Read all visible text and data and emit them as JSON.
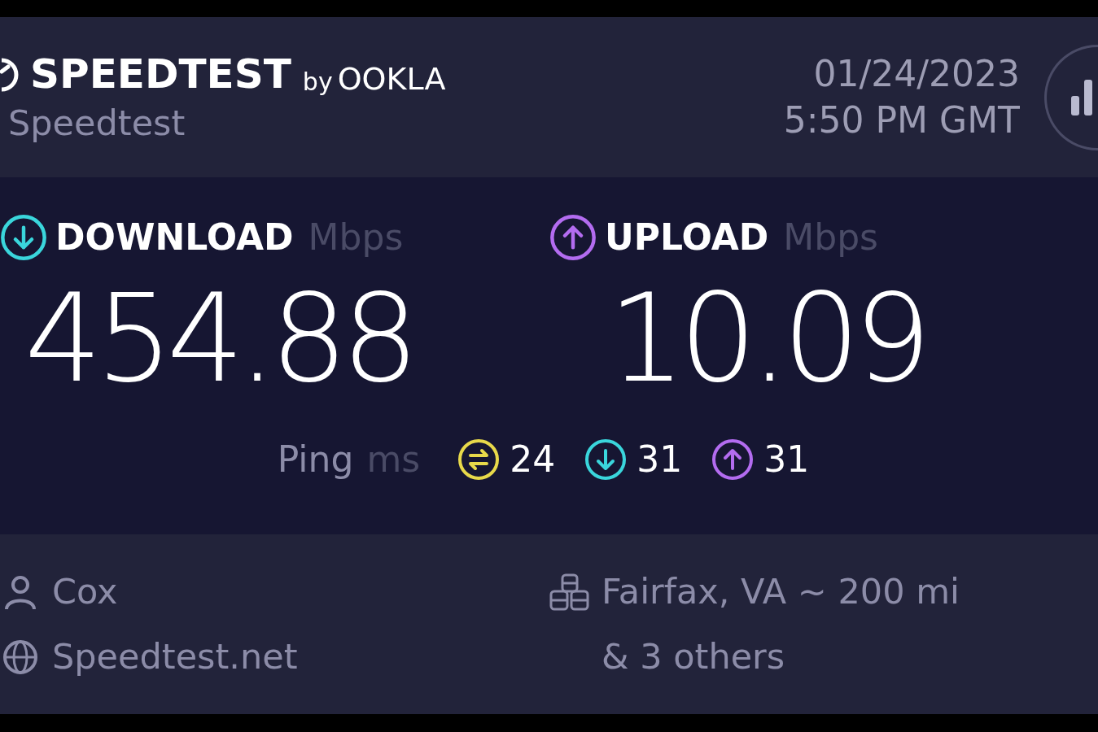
{
  "header": {
    "logo": {
      "name": "SPEEDTEST",
      "byline": "by",
      "brand": "OOKLA"
    },
    "handle": "Speedtest",
    "date": "01/24/2023",
    "time": "5:50 PM GMT"
  },
  "results": [
    {
      "kind": "download",
      "label": "DOWNLOAD",
      "unit": "Mbps",
      "value": "454.88",
      "color": "#3ad6dc"
    },
    {
      "kind": "upload",
      "label": "UPLOAD",
      "unit": "Mbps",
      "value": "10.09",
      "color": "#b36cf0"
    }
  ],
  "ping": {
    "label": "Ping",
    "unit": "ms",
    "readings": [
      {
        "kind": "idle",
        "value": "24",
        "color": "#e8d94a"
      },
      {
        "kind": "download",
        "value": "31",
        "color": "#3ad6dc"
      },
      {
        "kind": "upload",
        "value": "31",
        "color": "#b36cf0"
      }
    ]
  },
  "footer": {
    "isp": "Cox",
    "host": "Speedtest.net",
    "server": "Fairfax, VA ~ 200 mi",
    "others": "& 3 others"
  }
}
